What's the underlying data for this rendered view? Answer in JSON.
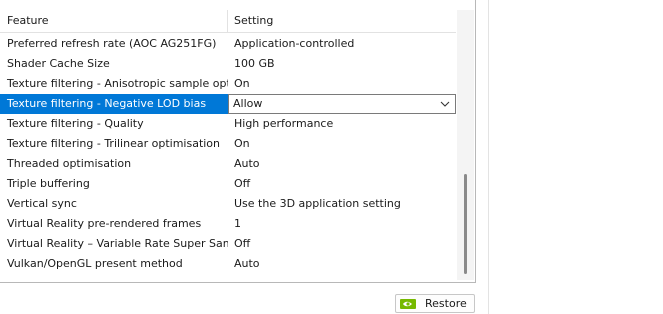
{
  "table": {
    "header_feature": "Feature",
    "header_setting": "Setting",
    "rows": [
      {
        "feature": "Preferred refresh rate (AOC AG251FG)",
        "setting": "Application-controlled"
      },
      {
        "feature": "Shader Cache Size",
        "setting": "100 GB"
      },
      {
        "feature": "Texture filtering - Anisotropic sample opti...",
        "setting": "On"
      },
      {
        "feature": "Texture filtering - Negative LOD bias",
        "setting": "Allow"
      },
      {
        "feature": "Texture filtering - Quality",
        "setting": "High performance"
      },
      {
        "feature": "Texture filtering - Trilinear optimisation",
        "setting": "On"
      },
      {
        "feature": "Threaded optimisation",
        "setting": "Auto"
      },
      {
        "feature": "Triple buffering",
        "setting": "Off"
      },
      {
        "feature": "Vertical sync",
        "setting": "Use the 3D application setting"
      },
      {
        "feature": "Virtual Reality pre-rendered frames",
        "setting": "1"
      },
      {
        "feature": "Virtual Reality – Variable Rate Super Samp...",
        "setting": "Off"
      },
      {
        "feature": "Vulkan/OpenGL present method",
        "setting": "Auto"
      }
    ]
  },
  "buttons": {
    "restore_label": "Restore"
  },
  "colors": {
    "selection": "#0078d7",
    "nvidia_green": "#76b900"
  },
  "icons": {
    "dropdown": "chevron-down-icon",
    "restore": "nvidia-logo-icon"
  }
}
